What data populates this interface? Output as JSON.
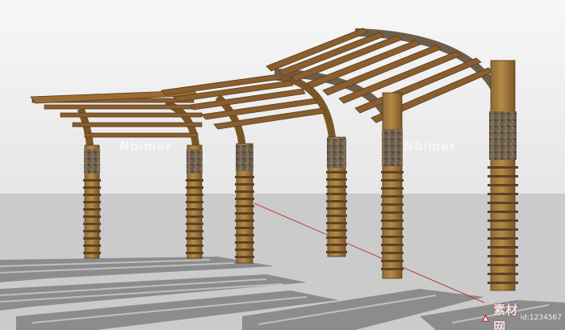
{
  "watermarks": {
    "left": "Nbimer",
    "right": "Nbimer",
    "logo_text": "素材网",
    "logo_site": "id:1234567"
  },
  "colors": {
    "sky": "#efefef",
    "ground": "#cbcbcb",
    "wood": "#8a5e2e",
    "wood_light": "#b2843e",
    "stone": "#6d5d4b",
    "shadow": "#7f7f7f",
    "axis_red": "#c43a3a"
  }
}
